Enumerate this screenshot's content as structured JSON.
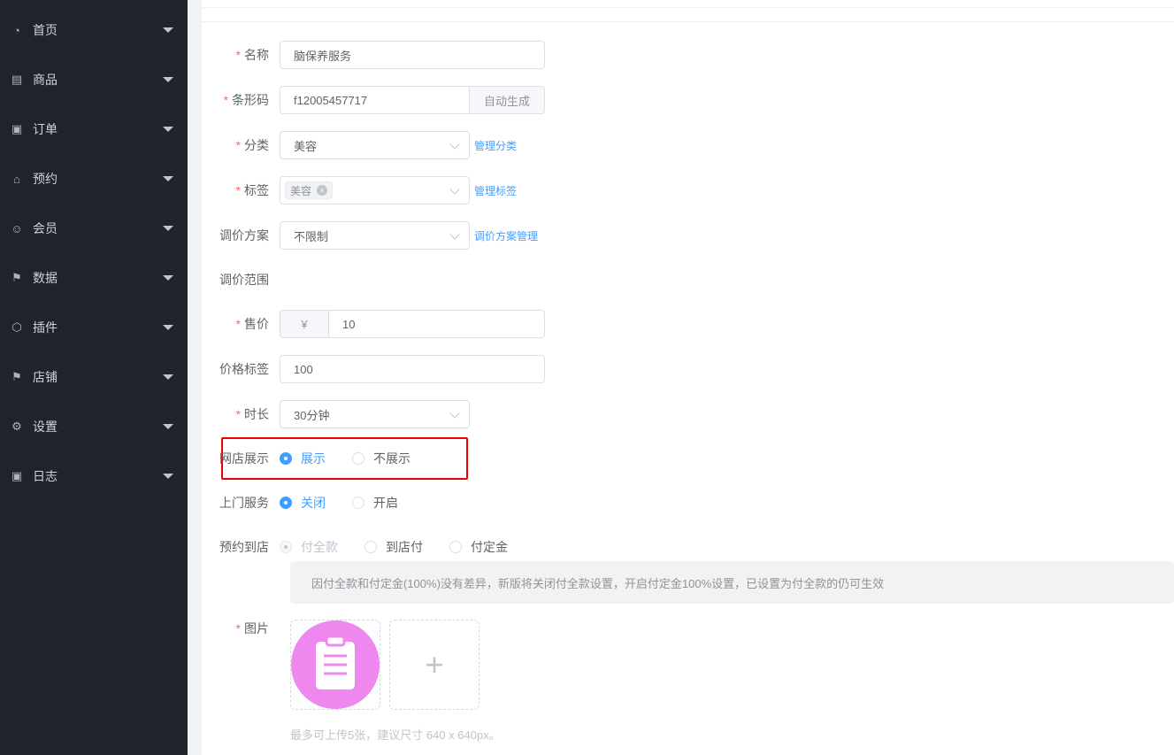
{
  "sidebar": {
    "items": [
      {
        "label": "首页",
        "icon": "dashboard-icon"
      },
      {
        "label": "商品",
        "icon": "document-icon"
      },
      {
        "label": "订单",
        "icon": "clipboard-icon"
      },
      {
        "label": "预约",
        "icon": "home-icon"
      },
      {
        "label": "会员",
        "icon": "user-icon"
      },
      {
        "label": "数据",
        "icon": "flag-icon"
      },
      {
        "label": "插件",
        "icon": "cube-icon"
      },
      {
        "label": "店铺",
        "icon": "flag-icon"
      },
      {
        "label": "设置",
        "icon": "gear-icon"
      },
      {
        "label": "日志",
        "icon": "clipboard-icon"
      }
    ]
  },
  "form": {
    "name": {
      "label": "名称",
      "value": "脑保养服务"
    },
    "barcode": {
      "label": "条形码",
      "value": "f12005457717",
      "button": "自动生成"
    },
    "category": {
      "label": "分类",
      "value": "美容",
      "link": "管理分类"
    },
    "tags": {
      "label": "标签",
      "tag": "美容",
      "link": "管理标签"
    },
    "price_plan": {
      "label": "调价方案",
      "value": "不限制",
      "link": "调价方案管理"
    },
    "price_range": {
      "label": "调价范围"
    },
    "price": {
      "label": "售价",
      "prefix": "¥",
      "value": "10"
    },
    "price_tag": {
      "label": "价格标签",
      "value": "100"
    },
    "duration": {
      "label": "时长",
      "value": "30分钟"
    },
    "online_display": {
      "label": "网店展示",
      "options": [
        "展示",
        "不展示"
      ],
      "selected": "展示"
    },
    "home_service": {
      "label": "上门服务",
      "options": [
        "关闭",
        "开启"
      ],
      "selected": "关闭"
    },
    "booking": {
      "label": "预约到店",
      "options": [
        "付全款",
        "到店付",
        "付定金"
      ],
      "disabled": "付全款",
      "notice": "因付全款和付定金(100%)没有差异，新版将关闭付全款设置，开启付定金100%设置，已设置为付全款的仍可生效"
    },
    "images": {
      "label": "图片",
      "tip": "最多可上传5张，建议尺寸 640 x 640px。"
    }
  },
  "colors": {
    "accent": "#409eff",
    "sidebar": "#20232a",
    "required": "#f56c6c",
    "highlight": "#ee0000"
  }
}
